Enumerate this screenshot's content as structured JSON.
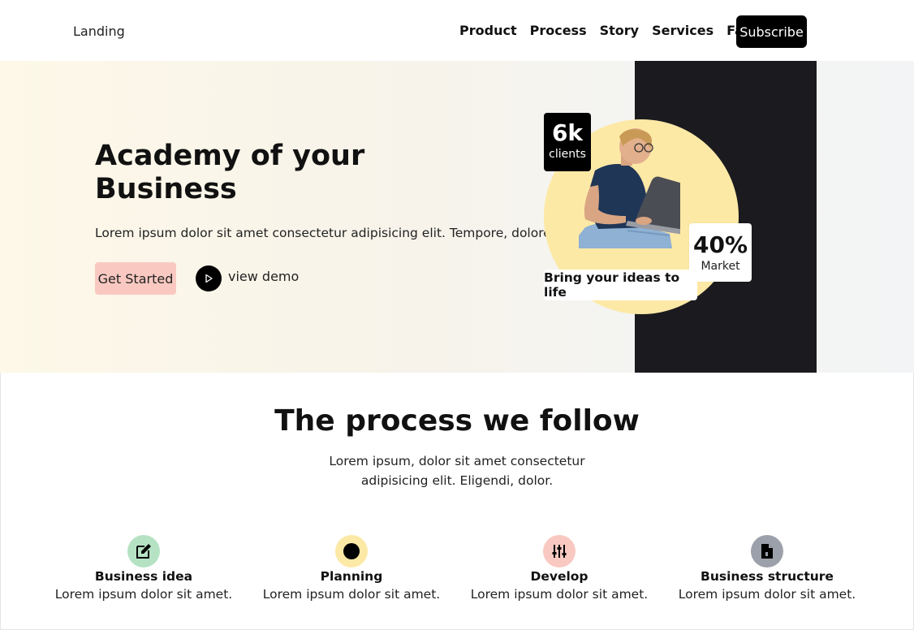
{
  "nav": {
    "logo": "Landing",
    "links": [
      "Product",
      "Process",
      "Story",
      "Services",
      "Faq"
    ],
    "subscribe": "Subscribe"
  },
  "hero": {
    "title": "Academy of your Business",
    "subtitle": "Lorem ipsum dolor sit amet consectetur adipisicing elit. Tempore, dolore?",
    "cta": "Get Started",
    "demo": "view demo",
    "stat1": {
      "value": "6k",
      "label": "clients"
    },
    "stat2": {
      "value": "40%",
      "label": "Market"
    },
    "tagline": "Bring your ideas to life"
  },
  "process": {
    "title": "The process we follow",
    "subtitle": "Lorem ipsum, dolor sit amet consectetur adipisicing elit. Eligendi, dolor.",
    "steps": [
      {
        "title": "Business idea",
        "text": "Lorem ipsum dolor sit amet.",
        "icon": "edit-icon",
        "color": "#b6e2c4"
      },
      {
        "title": "Planning",
        "text": "Lorem ipsum dolor sit amet.",
        "icon": "circle-icon",
        "color": "#fde9a6"
      },
      {
        "title": "Develop",
        "text": "Lorem ipsum dolor sit amet.",
        "icon": "sliders-icon",
        "color": "#f9c9c1"
      },
      {
        "title": "Business structure",
        "text": "Lorem ipsum dolor sit amet.",
        "icon": "document-icon",
        "color": "#9ca0aa"
      }
    ]
  }
}
